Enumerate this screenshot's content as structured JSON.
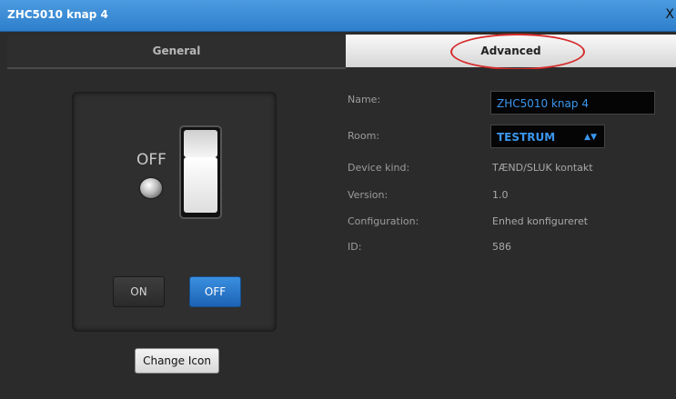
{
  "window": {
    "title": "ZHC5010 knap 4",
    "close_label": "X"
  },
  "tabs": [
    {
      "label": "General",
      "active": false
    },
    {
      "label": "Advanced",
      "active": true
    }
  ],
  "device": {
    "state_label": "OFF",
    "on_button": "ON",
    "off_button": "OFF",
    "change_icon": "Change Icon"
  },
  "advanced": {
    "name_label": "Name:",
    "name_value": "ZHC5010 knap 4",
    "room_label": "Room:",
    "room_value": "TESTRUM",
    "room_arrow": "▲▼",
    "kind_label": "Device kind:",
    "kind_value": "TÆND/SLUK kontakt",
    "version_label": "Version:",
    "version_value": "1.0",
    "config_label": "Configuration:",
    "config_value": "Enhed konfigureret",
    "id_label": "ID:",
    "id_value": "586"
  },
  "colors": {
    "accent": "#2f7fcc",
    "value_blue": "#3b96ee",
    "highlight": "#d62b2b"
  }
}
